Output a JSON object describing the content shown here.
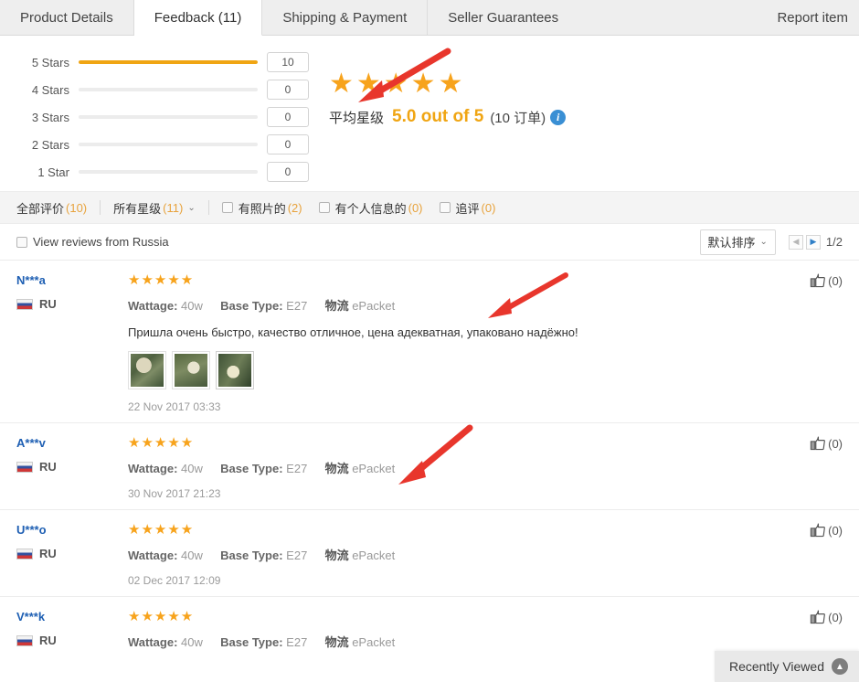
{
  "tabs": [
    {
      "label": "Product Details",
      "active": false
    },
    {
      "label": "Feedback (11)",
      "active": true
    },
    {
      "label": "Shipping & Payment",
      "active": false
    },
    {
      "label": "Seller Guarantees",
      "active": false
    }
  ],
  "report_item": "Report item",
  "rating_summary": {
    "rows": [
      {
        "label": "5 Stars",
        "count": "10",
        "percent": 100
      },
      {
        "label": "4 Stars",
        "count": "0",
        "percent": 0
      },
      {
        "label": "3 Stars",
        "count": "0",
        "percent": 0
      },
      {
        "label": "2 Stars",
        "count": "0",
        "percent": 0
      },
      {
        "label": "1 Star",
        "count": "0",
        "percent": 0
      }
    ],
    "stars_glyphs": "★★★★★",
    "average_label": "平均星级",
    "average_score": "5.0 out of 5",
    "orders_text": "(10 订单)",
    "info_glyph": "i",
    "bar_color": "#f0a513",
    "star_color": "#f7a31c"
  },
  "filters": {
    "all_reviews": {
      "label": "全部评价",
      "count": "(10)"
    },
    "all_stars": {
      "label": "所有星级",
      "count": "(11)",
      "chevron": "⌄"
    },
    "with_photos": {
      "label": "有照片的",
      "count": "(2)"
    },
    "with_personal_info": {
      "label": "有个人信息的",
      "count": "(0)"
    },
    "additional": {
      "label": "追评",
      "count": "(0)"
    }
  },
  "sort_row": {
    "view_from_country": "View reviews from Russia",
    "sort_label": "默认排序",
    "sort_chevron": "⌄",
    "prev_glyph": "◀",
    "next_glyph": "▶",
    "page_indicator": "1/2"
  },
  "reviews": [
    {
      "name": "N***a",
      "country": "RU",
      "stars": "★★★★★",
      "attr1_label": "Wattage:",
      "attr1_value": "40w",
      "attr2_label": "Base Type:",
      "attr2_value": "E27",
      "logistics_label": "物流",
      "logistics_value": "ePacket",
      "text": "Пришла очень быстро, качество отличное, цена адекватная, упаковано надёжно!",
      "photos": 3,
      "date": "22 Nov 2017 03:33",
      "helpful": "(0)"
    },
    {
      "name": "A***v",
      "country": "RU",
      "stars": "★★★★★",
      "attr1_label": "Wattage:",
      "attr1_value": "40w",
      "attr2_label": "Base Type:",
      "attr2_value": "E27",
      "logistics_label": "物流",
      "logistics_value": "ePacket",
      "text": "",
      "photos": 0,
      "date": "30 Nov 2017 21:23",
      "helpful": "(0)"
    },
    {
      "name": "U***o",
      "country": "RU",
      "stars": "★★★★★",
      "attr1_label": "Wattage:",
      "attr1_value": "40w",
      "attr2_label": "Base Type:",
      "attr2_value": "E27",
      "logistics_label": "物流",
      "logistics_value": "ePacket",
      "text": "",
      "photos": 0,
      "date": "02 Dec 2017 12:09",
      "helpful": "(0)"
    },
    {
      "name": "V***k",
      "country": "RU",
      "stars": "★★★★★",
      "attr1_label": "Wattage:",
      "attr1_value": "40w",
      "attr2_label": "Base Type:",
      "attr2_value": "E27",
      "logistics_label": "物流",
      "logistics_value": "ePacket",
      "text": "",
      "photos": 0,
      "date": "",
      "helpful": "(0)"
    }
  ],
  "recently_viewed": {
    "label": "Recently Viewed",
    "caret": "▲"
  },
  "annotations": {
    "arrow_color": "#e8362c"
  }
}
